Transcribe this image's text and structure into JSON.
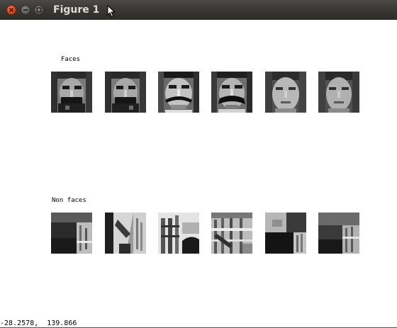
{
  "window": {
    "title": "Figure 1",
    "buttons": {
      "close": "close-icon",
      "minimize": "minimize-icon",
      "maximize": "maximize-icon"
    }
  },
  "figure": {
    "faces_label": "Faces",
    "nonfaces_label": "Non faces",
    "faces": [
      "face-1",
      "face-2",
      "face-3",
      "face-4",
      "face-5",
      "face-6"
    ],
    "nonfaces": [
      "nonface-1",
      "nonface-2",
      "nonface-3",
      "nonface-4",
      "nonface-5",
      "nonface-6"
    ]
  },
  "status": {
    "coordinates": "-28.2578,  139.866"
  }
}
